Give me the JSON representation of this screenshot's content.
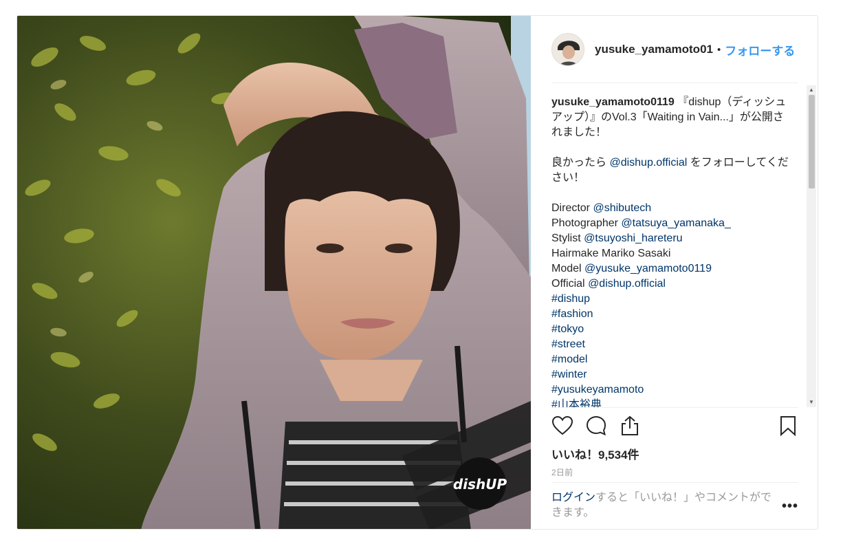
{
  "post": {
    "username": "yusuke_yamamoto0119",
    "dot": "•",
    "follow_label": "フォローする",
    "watermark": "dishUP",
    "caption": {
      "author": "yusuke_yamamoto0119",
      "line1": " 『dishup（ディッシュアップ）』のVol.3「Waiting in Vain...」が公開されました！",
      "line2_pre": "良かったら ",
      "line2_link": "@dishup.official",
      "line2_post": " をフォローしてください！",
      "credits": [
        {
          "role": "Director ",
          "handle": "@shibutech"
        },
        {
          "role": "Photographer ",
          "handle": "@tatsuya_yamanaka_"
        },
        {
          "role": "Stylist ",
          "handle": "@tsuyoshi_hareteru"
        },
        {
          "role": "Hairmake Mariko Sasaki",
          "handle": ""
        },
        {
          "role": "Model ",
          "handle": "@yusuke_yamamoto0119"
        },
        {
          "role": "Official ",
          "handle": "@dishup.official"
        }
      ],
      "hashtags": [
        "#dishup",
        "#fashion",
        "#tokyo",
        "#street",
        "#model",
        "#winter",
        "#yusukeyamamoto",
        "#山本裕典"
      ]
    },
    "actions": {
      "like_icon": "heart-icon",
      "comment_icon": "comment-icon",
      "share_icon": "share-icon",
      "save_icon": "bookmark-icon"
    },
    "likes_text": "いいね！9,534件",
    "time_text": "2日前",
    "login_link": "ログイン",
    "login_rest": "すると「いいね！」やコメントができます。",
    "more_label": "•••",
    "colors": {
      "link": "#003569",
      "follow": "#3897f0",
      "muted": "#999999",
      "text": "#262626"
    }
  }
}
